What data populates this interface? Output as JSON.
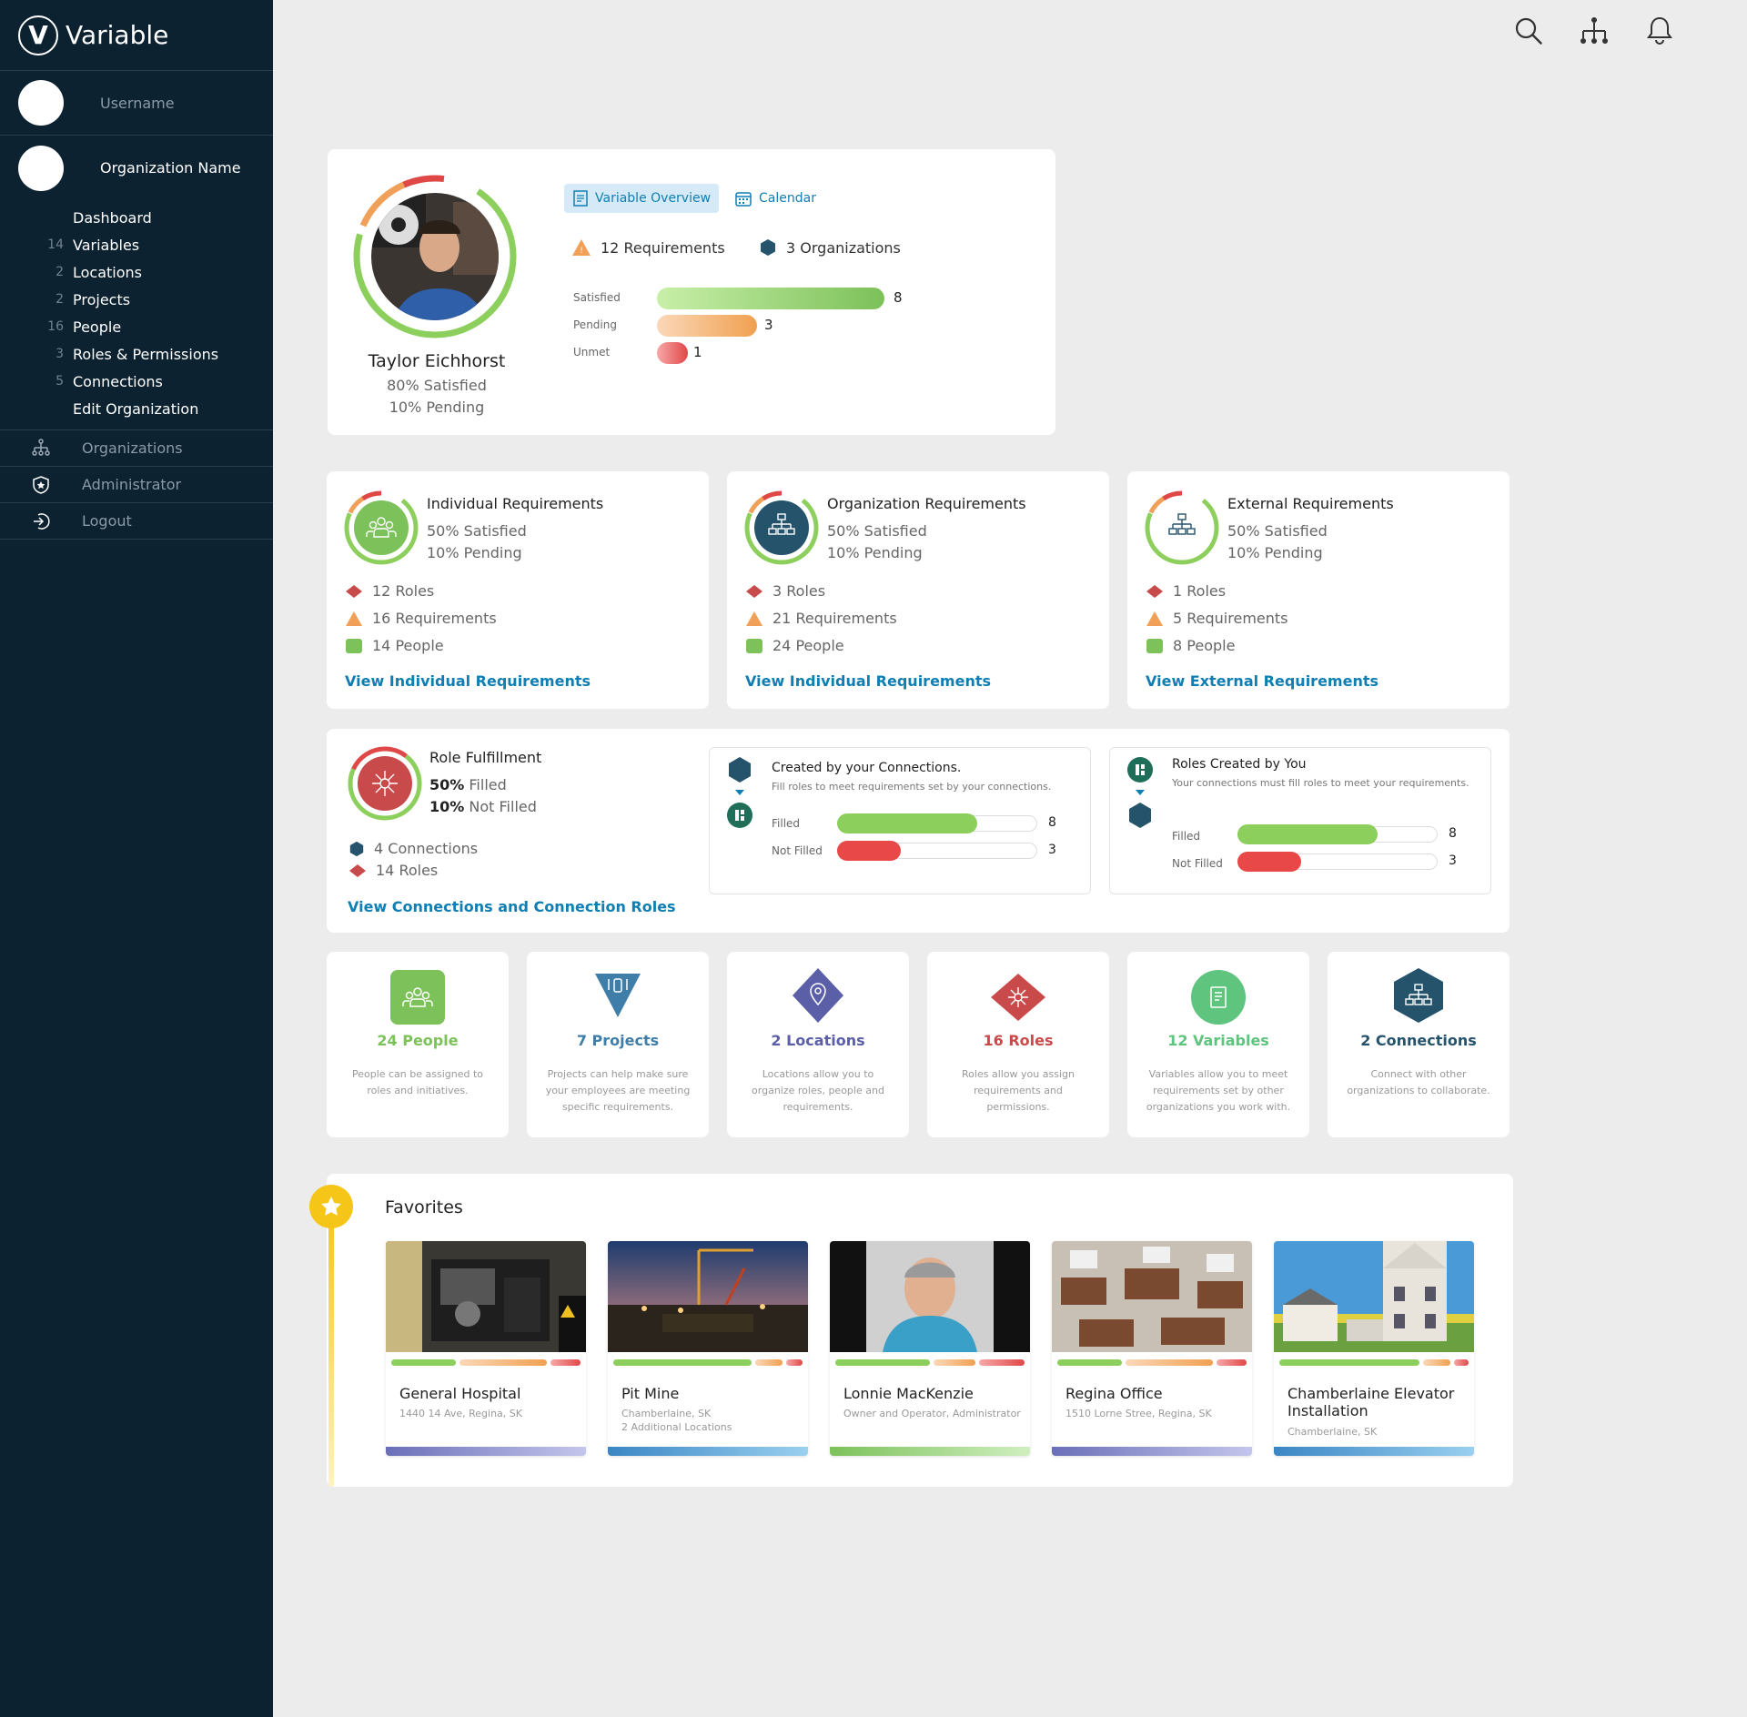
{
  "brand": {
    "name": "Variable",
    "mark": "V"
  },
  "sidebar": {
    "username": "Username",
    "org_name": "Organization Name",
    "items": [
      {
        "count": "",
        "label": "Dashboard"
      },
      {
        "count": "14",
        "label": "Variables"
      },
      {
        "count": "2",
        "label": "Locations"
      },
      {
        "count": "2",
        "label": "Projects"
      },
      {
        "count": "16",
        "label": "People"
      },
      {
        "count": "3",
        "label": "Roles & Permissions"
      },
      {
        "count": "5",
        "label": "Connections"
      },
      {
        "count": "",
        "label": "Edit Organization"
      }
    ],
    "lower": [
      {
        "icon": "org-chart-icon",
        "label": "Organizations"
      },
      {
        "icon": "shield-star-icon",
        "label": "Administrator"
      },
      {
        "icon": "logout-icon",
        "label": "Logout"
      }
    ]
  },
  "topbar": {
    "icons": [
      "search-icon",
      "org-chart-icon",
      "bell-icon"
    ]
  },
  "profile": {
    "name": "Taylor Eichhorst",
    "satisfied": "80% Satisfied",
    "pending": "10% Pending",
    "tabs": [
      {
        "label": "Variable Overview"
      },
      {
        "label": "Calendar"
      }
    ],
    "requirements": "12 Requirements",
    "organizations": "3 Organizations",
    "bars": [
      {
        "label": "Satisfied",
        "value": 8
      },
      {
        "label": "Pending",
        "value": 3
      },
      {
        "label": "Unmet",
        "value": 1
      }
    ]
  },
  "req_cards": [
    {
      "title": "Individual Requirements",
      "satisfied": "50% Satisfied",
      "pending": "10% Pending",
      "roles": "12 Roles",
      "requirements": "16 Requirements",
      "people": "14 People",
      "link": "View Individual Requirements"
    },
    {
      "title": "Organization Requirements",
      "satisfied": "50% Satisfied",
      "pending": "10% Pending",
      "roles": "3 Roles",
      "requirements": "21 Requirements",
      "people": "24 People",
      "link": "View Individual Requirements"
    },
    {
      "title": "External Requirements",
      "satisfied": "50% Satisfied",
      "pending": "10% Pending",
      "roles": "1 Roles",
      "requirements": "5 Requirements",
      "people": "8 People",
      "link": "View External Requirements"
    }
  ],
  "role_fulfillment": {
    "title": "Role Fulfillment",
    "filled_pct": "50%",
    "filled_word": "Filled",
    "not_filled_pct": "10%",
    "not_filled_word": "Not Filled",
    "connections": "4 Connections",
    "roles": "14 Roles",
    "link": "View Connections and Connection Roles",
    "panels": [
      {
        "title": "Created by your Connections.",
        "subtitle": "Fill roles to meet requirements set by your connections.",
        "filled_label": "Filled",
        "filled": 8,
        "not_filled_label": "Not Filled",
        "not_filled": 3
      },
      {
        "title": "Roles Created by You",
        "subtitle": "Your connections must fill roles to meet your requirements.",
        "filled_label": "Filled",
        "filled": 8,
        "not_filled_label": "Not Filled",
        "not_filled": 3
      }
    ]
  },
  "stats": [
    {
      "title": "24 People",
      "desc": "People can be assigned to roles and initiatives.",
      "color": "#7cc15a"
    },
    {
      "title": "7 Projects",
      "desc": "Projects can help make sure your employees are meeting specific requirements.",
      "color": "#3f7ea8"
    },
    {
      "title": "2 Locations",
      "desc": "Locations allow you to organize roles, people and requirements.",
      "color": "#5a5fa8"
    },
    {
      "title": "16 Roles",
      "desc": "Roles allow you assign requirements and permissions.",
      "color": "#c94a4a"
    },
    {
      "title": "12 Variables",
      "desc": "Variables allow you to meet requirements set by other organizations you work with.",
      "color": "#5ec47e"
    },
    {
      "title": "2 Connections",
      "desc": "Connect with other organizations to collaborate.",
      "color": "#24536b"
    }
  ],
  "favorites": {
    "title": "Favorites",
    "items": [
      {
        "name": "General Hospital",
        "sub1": "1440 14 Ave, Regina, SK",
        "sub2": "",
        "bottom": "#6a6fb8"
      },
      {
        "name": "Pit Mine",
        "sub1": "Chamberlaine, SK",
        "sub2": "2 Additional Locations",
        "bottom": "#5a9fd4"
      },
      {
        "name": "Lonnie MacKenzie",
        "sub1": "Owner and Operator, Administrator",
        "sub2": "",
        "bottom": "#8bd06a"
      },
      {
        "name": "Regina Office",
        "sub1": "1510 Lorne Stree, Regina, SK",
        "sub2": "",
        "bottom": "#6a6fb8"
      },
      {
        "name": "Chamberlaine Elevator Installation",
        "sub1": "Chamberlaine, SK",
        "sub2": "",
        "bottom": "#5a9fd4"
      }
    ]
  },
  "colors": {
    "sidebar": "#0d2231",
    "accent_link": "#0f7fb3",
    "green": "#8bcf63",
    "orange": "#f0a058",
    "red": "#e85050",
    "yellow": "#f5c518"
  }
}
